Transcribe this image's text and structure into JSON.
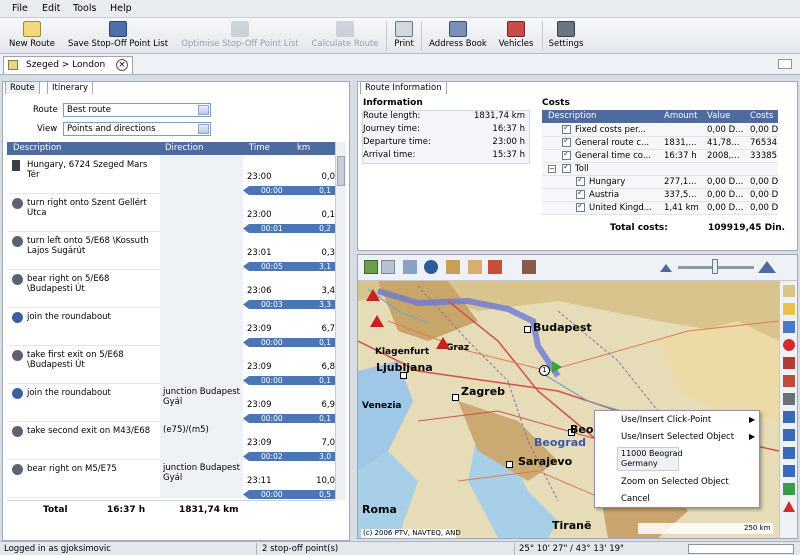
{
  "menu": [
    "File",
    "Edit",
    "Tools",
    "Help"
  ],
  "toolbar": {
    "new_route": "New Route",
    "save_stopoff": "Save Stop-Off Point List",
    "optimise_stopoff": "Optimise Stop-Off Point List",
    "calculate_route": "Calculate Route",
    "print": "Print",
    "address_book": "Address Book",
    "vehicles": "Vehicles",
    "settings": "Settings"
  },
  "route_tab": {
    "title": "Szeged > London"
  },
  "left": {
    "tab_route": "Route",
    "tab_itinerary": "Itinerary",
    "route_label": "Route",
    "route_value": "Best route",
    "view_label": "View",
    "view_value": "Points and directions",
    "headers": {
      "description": "Description",
      "direction": "Direction",
      "time": "Time",
      "km": "km"
    },
    "rows": [
      {
        "desc": "Hungary, 6724 Szeged Mars Tér",
        "direction": "",
        "time": "23:00",
        "km": "0,0",
        "leg_time": "00:00",
        "leg_km": "0,1"
      },
      {
        "desc": "turn right onto Szent Gellért Utca",
        "direction": "",
        "time": "23:00",
        "km": "0,1",
        "leg_time": "00:01",
        "leg_km": "0,2"
      },
      {
        "desc": "turn left onto 5/E68 \\Kossuth Lajos Sugárút",
        "direction": "",
        "time": "23:01",
        "km": "0,3",
        "leg_time": "00:05",
        "leg_km": "3,1"
      },
      {
        "desc": "bear right on 5/E68 \\Budapesti Út",
        "direction": "",
        "time": "23:06",
        "km": "3,4",
        "leg_time": "00:03",
        "leg_km": "3,3"
      },
      {
        "desc": "join the roundabout",
        "direction": "",
        "time": "23:09",
        "km": "6,7",
        "leg_time": "00:00",
        "leg_km": "0,1"
      },
      {
        "desc": "take first exit on 5/E68 \\Budapesti Út",
        "direction": "",
        "time": "23:09",
        "km": "6,8",
        "leg_time": "00:00",
        "leg_km": "0,1"
      },
      {
        "desc": "join the roundabout",
        "direction": "junction Budapest Gyál",
        "time": "23:09",
        "km": "6,9",
        "leg_time": "00:00",
        "leg_km": "0,1"
      },
      {
        "desc": "take second exit on M43/E68",
        "direction": "(e75)/(m5)",
        "time": "23:09",
        "km": "7,0",
        "leg_time": "00:02",
        "leg_km": "3,0"
      },
      {
        "desc": "bear right on M5/E75",
        "direction": "junction Budapest Gyál",
        "time": "23:11",
        "km": "10,0",
        "leg_time": "00:00",
        "leg_km": "0,5"
      }
    ],
    "total_label": "Total",
    "total_time": "16:37 h",
    "total_km": "1831,74 km"
  },
  "right": {
    "tab": "Route Information",
    "info_title": "Information",
    "info": [
      {
        "label": "Route length:",
        "value": "1831,74 km"
      },
      {
        "label": "Journey time:",
        "value": "16:37 h"
      },
      {
        "label": "Departure time:",
        "value": "23:00 h"
      },
      {
        "label": "Arrival time:",
        "value": "15:37 h"
      }
    ],
    "costs_title": "Costs",
    "cost_headers": {
      "description": "Description",
      "amount": "Amount",
      "value": "Value",
      "costs": "Costs"
    },
    "cost_rows": [
      {
        "desc": "Fixed costs per...",
        "amount": "",
        "value": "0,00 D...",
        "costs": "0,00 D..."
      },
      {
        "desc": "General route c...",
        "amount": "1831,...",
        "value": "41,78...",
        "costs": "76534..."
      },
      {
        "desc": "General time co...",
        "amount": "16:37 h",
        "value": "2008,...",
        "costs": "33385..."
      },
      {
        "desc": "Toll",
        "amount": "",
        "value": "",
        "costs": ""
      },
      {
        "desc": "Hungary",
        "amount": "277,1...",
        "value": "0,00 D...",
        "costs": "0,00 D..."
      },
      {
        "desc": "Austria",
        "amount": "337,5...",
        "value": "0,00 D...",
        "costs": "0,00 D..."
      },
      {
        "desc": "United Kingd...",
        "amount": "1,41 km",
        "value": "0,00 D...",
        "costs": "0,00 D..."
      }
    ],
    "total_label": "Total costs:",
    "total_value": "109919,45 Din."
  },
  "map": {
    "cities": [
      "Budapest",
      "Ljubljana",
      "Zagreb",
      "Beograd",
      "Sarajevo",
      "Venezia",
      "Klagenfurt",
      "Graz",
      "Roma",
      "Tiranë"
    ],
    "copyright": "(c) 2006 PTV, NAVTEQ, AND",
    "scale": "250 km",
    "highlight_city": "Beograd"
  },
  "context_menu": {
    "items": [
      "Use/Insert Click-Point",
      "Use/Insert Selected Object",
      "11000 Beograd",
      "Germany",
      "Zoom on Selected Object",
      "Cancel"
    ]
  },
  "status": {
    "user": "Logged in as gjoksimovic",
    "stopoffs": "2 stop-off point(s)",
    "coords": "25° 10' 27\" / 43° 13' 19\""
  }
}
